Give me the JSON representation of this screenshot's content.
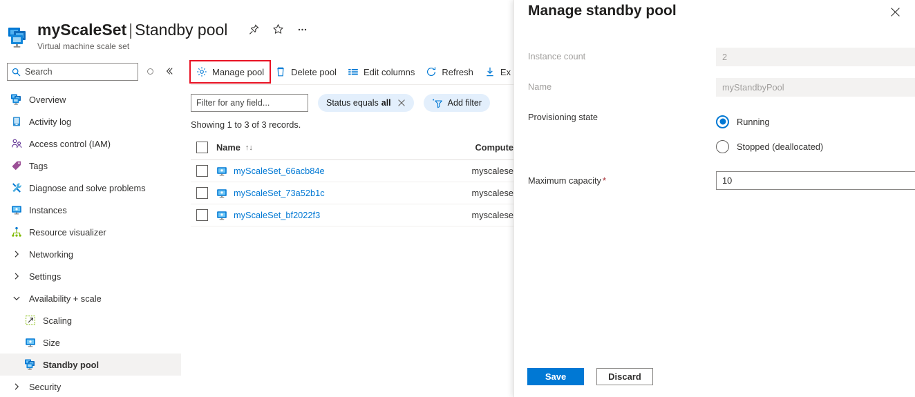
{
  "header": {
    "resource_name": "myScaleSet",
    "separator": "|",
    "page_name": "Standby pool",
    "subtitle": "Virtual machine scale set",
    "icons": [
      "pin-icon",
      "star-icon",
      "ellipsis-icon"
    ]
  },
  "sidebar": {
    "search_placeholder": "Search",
    "items": [
      {
        "label": "Overview",
        "icon": "scale-set-icon",
        "type": "item"
      },
      {
        "label": "Activity log",
        "icon": "activity-log-icon",
        "type": "item"
      },
      {
        "label": "Access control (IAM)",
        "icon": "access-control-icon",
        "type": "item"
      },
      {
        "label": "Tags",
        "icon": "tag-icon",
        "type": "item"
      },
      {
        "label": "Diagnose and solve problems",
        "icon": "wrench-icon",
        "type": "item"
      },
      {
        "label": "Instances",
        "icon": "monitor-icon",
        "type": "item"
      },
      {
        "label": "Resource visualizer",
        "icon": "resource-visualizer-icon",
        "type": "item"
      },
      {
        "label": "Networking",
        "icon": "chevron-right-icon",
        "type": "group"
      },
      {
        "label": "Settings",
        "icon": "chevron-right-icon",
        "type": "group"
      },
      {
        "label": "Availability + scale",
        "icon": "chevron-down-icon",
        "type": "group-expanded"
      },
      {
        "label": "Scaling",
        "icon": "scaling-icon",
        "type": "sub"
      },
      {
        "label": "Size",
        "icon": "monitor-icon",
        "type": "sub"
      },
      {
        "label": "Standby pool",
        "icon": "scale-set-icon",
        "type": "sub",
        "selected": true
      },
      {
        "label": "Security",
        "icon": "chevron-right-icon",
        "type": "group"
      }
    ]
  },
  "toolbar": {
    "commands": [
      {
        "label": "Manage pool",
        "icon": "gear-icon",
        "highlighted": true
      },
      {
        "label": "Delete pool",
        "icon": "trash-icon",
        "highlighted": false
      },
      {
        "label": "Edit columns",
        "icon": "columns-icon",
        "highlighted": false
      },
      {
        "label": "Refresh",
        "icon": "refresh-icon",
        "highlighted": false
      },
      {
        "label": "Ex",
        "icon": "download-icon",
        "highlighted": false
      }
    ]
  },
  "filters": {
    "field_placeholder": "Filter for any field...",
    "status_pill_prefix": "Status equals",
    "status_pill_value": "all",
    "add_filter_label": "Add filter"
  },
  "grid": {
    "records_text": "Showing 1 to 3 of 3 records.",
    "columns": [
      {
        "label": "Name",
        "sort_glyph": "↑↓"
      },
      {
        "label": "Compute"
      }
    ],
    "rows": [
      {
        "name": "myScaleSet_66acb84e",
        "compute": "myscalese",
        "icon": "monitor-icon"
      },
      {
        "name": "myScaleSet_73a52b1c",
        "compute": "myscalese",
        "icon": "monitor-icon"
      },
      {
        "name": "myScaleSet_bf2022f3",
        "compute": "myscalese",
        "icon": "monitor-icon"
      }
    ]
  },
  "blade": {
    "title": "Manage standby pool",
    "close_icon": "close-icon",
    "fields": {
      "instance_count_label": "Instance count",
      "instance_count_value": "2",
      "name_label": "Name",
      "name_value": "myStandbyPool",
      "provisioning_state_label": "Provisioning state",
      "provisioning_options": [
        {
          "label": "Running",
          "selected": true
        },
        {
          "label": "Stopped (deallocated)",
          "selected": false
        }
      ],
      "maximum_capacity_label": "Maximum capacity",
      "maximum_capacity_required_mark": "*",
      "maximum_capacity_value": "10"
    },
    "actions": {
      "save_label": "Save",
      "discard_label": "Discard"
    }
  },
  "colors": {
    "accent": "#0078d4",
    "link": "#0078d4",
    "highlight_box": "#e81123",
    "pill_bg": "#e3effc",
    "selected_nav_bg": "#f3f2f1",
    "disabled_field_bg": "#f3f2f1",
    "required_mark": "#a4262c"
  }
}
